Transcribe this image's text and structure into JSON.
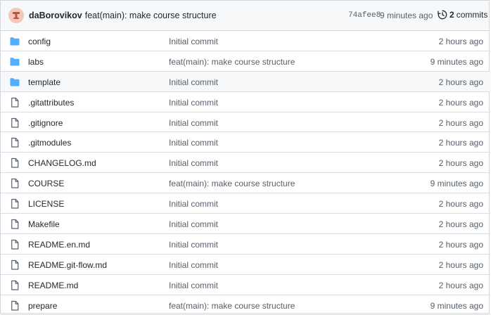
{
  "header": {
    "author": "daBorovikov",
    "message": "feat(main): make course structure",
    "sha": "74afee8",
    "time": "9 minutes ago",
    "commit_count": "2",
    "commits_label": "commits"
  },
  "files": [
    {
      "type": "folder",
      "icon": "folder-icon",
      "name": "config",
      "message": "Initial commit",
      "time": "2 hours ago"
    },
    {
      "type": "folder",
      "icon": "folder-icon",
      "name": "labs",
      "message": "feat(main): make course structure",
      "time": "9 minutes ago"
    },
    {
      "type": "folder",
      "icon": "folder-icon",
      "name": "template",
      "message": "Initial commit",
      "time": "2 hours ago"
    },
    {
      "type": "file",
      "icon": "file-icon",
      "name": ".gitattributes",
      "message": "Initial commit",
      "time": "2 hours ago"
    },
    {
      "type": "file",
      "icon": "file-icon",
      "name": ".gitignore",
      "message": "Initial commit",
      "time": "2 hours ago"
    },
    {
      "type": "file",
      "icon": "file-icon",
      "name": ".gitmodules",
      "message": "Initial commit",
      "time": "2 hours ago"
    },
    {
      "type": "file",
      "icon": "file-icon",
      "name": "CHANGELOG.md",
      "message": "Initial commit",
      "time": "2 hours ago"
    },
    {
      "type": "file",
      "icon": "file-icon",
      "name": "COURSE",
      "message": "feat(main): make course structure",
      "time": "9 minutes ago"
    },
    {
      "type": "file",
      "icon": "file-icon",
      "name": "LICENSE",
      "message": "Initial commit",
      "time": "2 hours ago"
    },
    {
      "type": "file",
      "icon": "file-icon",
      "name": "Makefile",
      "message": "Initial commit",
      "time": "2 hours ago"
    },
    {
      "type": "file",
      "icon": "file-icon",
      "name": "README.en.md",
      "message": "Initial commit",
      "time": "2 hours ago"
    },
    {
      "type": "file",
      "icon": "file-icon",
      "name": "README.git-flow.md",
      "message": "Initial commit",
      "time": "2 hours ago"
    },
    {
      "type": "file",
      "icon": "file-icon",
      "name": "README.md",
      "message": "Initial commit",
      "time": "2 hours ago"
    },
    {
      "type": "file",
      "icon": "file-icon",
      "name": "prepare",
      "message": "feat(main): make course structure",
      "time": "9 minutes ago"
    }
  ],
  "colors": {
    "folder": "#54aeff",
    "file_icon": "#57606a",
    "header_bg": "#f6f8fa",
    "border": "#d0d7de"
  }
}
